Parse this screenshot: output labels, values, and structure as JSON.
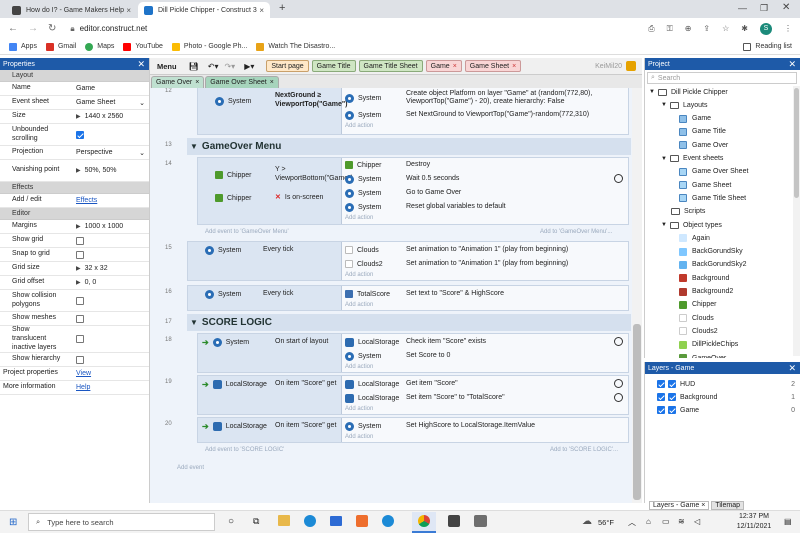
{
  "browser": {
    "tabs": [
      {
        "title": "How do I? - Game Makers Help",
        "active": false
      },
      {
        "title": "Dill Pickle Chipper - Construct 3",
        "active": true
      }
    ],
    "new_tab": "+",
    "url": "editor.construct.net",
    "bookmarks": [
      "Apps",
      "Gmail",
      "Maps",
      "YouTube",
      "Photo - Google Ph...",
      "Watch The Disastro..."
    ],
    "reading_list": "Reading list",
    "profile": "S"
  },
  "properties": {
    "title": "Properties",
    "sections": {
      "layout": "Layout",
      "effects": "Effects",
      "editor": "Editor"
    },
    "rows": {
      "name": {
        "k": "Name",
        "v": "Game"
      },
      "event_sheet": {
        "k": "Event sheet",
        "v": "Game Sheet"
      },
      "size": {
        "k": "Size",
        "v": "1440 x 2560"
      },
      "unbounded": {
        "k": "Unbounded scrolling",
        "checked": true
      },
      "projection": {
        "k": "Projection",
        "v": "Perspective"
      },
      "vanishing": {
        "k": "Vanishing point",
        "v": "50%, 50%"
      },
      "add_edit": {
        "k": "Add / edit",
        "v": "Effects"
      },
      "margins": {
        "k": "Margins",
        "v": "1000 x 1000"
      },
      "show_grid": {
        "k": "Show grid",
        "checked": false
      },
      "snap": {
        "k": "Snap to grid",
        "checked": false
      },
      "grid_size": {
        "k": "Grid size",
        "v": "32 x 32"
      },
      "grid_offset": {
        "k": "Grid offset",
        "v": "0, 0"
      },
      "collision": {
        "k": "Show collision polygons",
        "checked": false
      },
      "meshes": {
        "k": "Show meshes",
        "checked": false
      },
      "translucent": {
        "k": "Show translucent inactive layers",
        "checked": false
      },
      "hierarchy": {
        "k": "Show hierarchy",
        "checked": false
      },
      "project_props": {
        "k": "Project properties",
        "v": "View"
      },
      "more_info": {
        "k": "More information",
        "v": "Help"
      }
    }
  },
  "toolbar": {
    "menu": "Menu",
    "tabs": [
      "Start page",
      "Game Title",
      "Game Title Sheet",
      "Game",
      "Game Sheet"
    ],
    "user": "KeiMil20"
  },
  "doc_tabs": [
    "Game Over",
    "Game Over Sheet"
  ],
  "sheet": {
    "add_action": "Add action",
    "add_event": "Add event",
    "events": {
      "e12": {
        "ln": "12",
        "cobj": "System",
        "cval": "NextGround ≥ ViewportTop(\"Game\")",
        "a1obj": "System",
        "a1": "Create object Platform on layer \"Game\" at (random(772,80), ViewportTop(\"Game\") - 20), create hierarchy: False",
        "a2obj": "System",
        "a2": "Set NextGround to ViewportTop(\"Game\")-random(772,310)"
      },
      "g13": {
        "ln": "13",
        "title": "GameOver Menu"
      },
      "e14": {
        "ln": "14",
        "c1obj": "Chipper",
        "c1": "Y > ViewportBottom(\"Game\")",
        "c2obj": "Chipper",
        "c2": "Is on-screen",
        "a1obj": "Chipper",
        "a1": "Destroy",
        "a2obj": "System",
        "a2": "Wait 0.5 seconds",
        "a3obj": "System",
        "a3": "Go to Game Over",
        "a4obj": "System",
        "a4": "Reset global variables to default"
      },
      "add_event_gom": "Add event to 'GameOver Menu'",
      "add_to_gom": "Add to 'GameOver Menu'...",
      "e15": {
        "ln": "15",
        "cobj": "System",
        "cval": "Every tick",
        "a1obj": "Clouds",
        "a1": "Set animation to \"Animation 1\" (play from beginning)",
        "a2obj": "Clouds2",
        "a2": "Set animation to \"Animation 1\" (play from beginning)"
      },
      "e16": {
        "ln": "16",
        "cobj": "System",
        "cval": "Every tick",
        "a1obj": "TotalScore",
        "a1": "Set text to \"Score\" & HighScore"
      },
      "g17": {
        "ln": "17",
        "title": "SCORE LOGIC"
      },
      "e18": {
        "ln": "18",
        "cobj": "System",
        "cval": "On start of layout",
        "a1obj": "LocalStorage",
        "a1": "Check item \"Score\" exists",
        "a2obj": "System",
        "a2": "Set Score to 0"
      },
      "e19": {
        "ln": "19",
        "cobj": "LocalStorage",
        "cval": "On item \"Score\" get",
        "a1obj": "LocalStorage",
        "a1": "Get item \"Score\"",
        "a2obj": "LocalStorage",
        "a2": "Set item \"Score\" to \"TotalScore\""
      },
      "e20": {
        "ln": "20",
        "cobj": "LocalStorage",
        "cval": "On item \"Score\" get",
        "a1obj": "System",
        "a1": "Set HighScore to LocalStorage.ItemValue"
      },
      "add_event_sl": "Add event to 'SCORE LOGIC'",
      "add_to_sl": "Add to 'SCORE LOGIC'..."
    }
  },
  "project": {
    "title": "Project",
    "search_placeholder": "Search",
    "items": [
      {
        "label": "Dill Pickle Chipper",
        "depth": 0,
        "kind": "folder"
      },
      {
        "label": "Layouts",
        "depth": 1,
        "kind": "folder"
      },
      {
        "label": "Game",
        "depth": 2,
        "kind": "layout"
      },
      {
        "label": "Game Title",
        "depth": 2,
        "kind": "layout"
      },
      {
        "label": "Game Over",
        "depth": 2,
        "kind": "layout"
      },
      {
        "label": "Event sheets",
        "depth": 1,
        "kind": "folder"
      },
      {
        "label": "Game Over Sheet",
        "depth": 2,
        "kind": "sheet"
      },
      {
        "label": "Game Sheet",
        "depth": 2,
        "kind": "sheet"
      },
      {
        "label": "Game Title Sheet",
        "depth": 2,
        "kind": "sheet"
      },
      {
        "label": "Scripts",
        "depth": 1,
        "kind": "folder"
      },
      {
        "label": "Object types",
        "depth": 1,
        "kind": "folder"
      },
      {
        "label": "Again",
        "depth": 2,
        "kind": "obj"
      },
      {
        "label": "BackGorundSky",
        "depth": 2,
        "kind": "obj"
      },
      {
        "label": "BackGorundSky2",
        "depth": 2,
        "kind": "obj"
      },
      {
        "label": "Background",
        "depth": 2,
        "kind": "obj"
      },
      {
        "label": "Background2",
        "depth": 2,
        "kind": "obj"
      },
      {
        "label": "Chipper",
        "depth": 2,
        "kind": "obj"
      },
      {
        "label": "Clouds",
        "depth": 2,
        "kind": "obj"
      },
      {
        "label": "Clouds2",
        "depth": 2,
        "kind": "obj"
      },
      {
        "label": "DillPickleChips",
        "depth": 2,
        "kind": "obj"
      },
      {
        "label": "GameOver",
        "depth": 2,
        "kind": "obj"
      }
    ]
  },
  "layers": {
    "title": "Layers - Game",
    "items": [
      {
        "name": "HUD",
        "num": "2"
      },
      {
        "name": "Background",
        "num": "1"
      },
      {
        "name": "Game",
        "num": "0"
      }
    ],
    "bottom_tabs": [
      "Layers - Game",
      "Tilemap"
    ]
  },
  "taskbar": {
    "search_placeholder": "Type here to search",
    "temp": "56°F",
    "time": "12:37 PM",
    "date": "12/11/2021"
  },
  "colors": {
    "accent": "#1e5aa8",
    "group_bar": "#d5e0ee",
    "sheet_bg": "#eef3fa"
  }
}
